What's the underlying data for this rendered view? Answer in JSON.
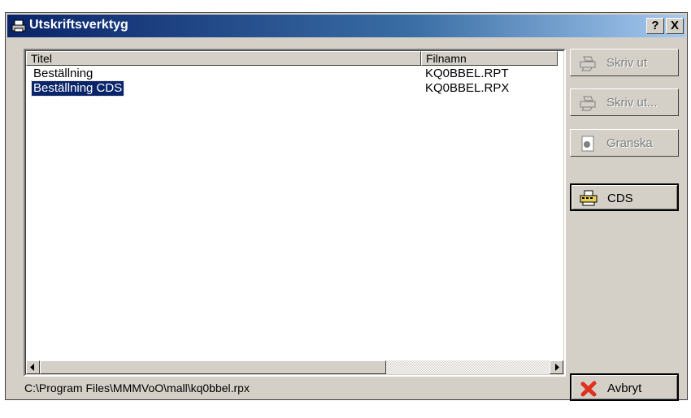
{
  "window": {
    "title": "Utskriftsverktyg",
    "help_label": "?",
    "close_label": "X"
  },
  "list": {
    "columns": [
      "Titel",
      "Filnamn"
    ],
    "rows": [
      {
        "title": "Beställning",
        "file": "KQ0BBEL.RPT",
        "selected": false
      },
      {
        "title": "Beställning CDS",
        "file": "KQ0BBEL.RPX",
        "selected": true
      }
    ]
  },
  "buttons": {
    "print_label": "Skriv ut",
    "print_dialog_label": "Skriv ut...",
    "preview_label": "Granska",
    "cds_label": "CDS",
    "cancel_label": "Avbryt"
  },
  "status": {
    "path": "C:\\Program Files\\MMMVoO\\mall\\kq0bbel.rpx"
  },
  "colors": {
    "selection": "#0a246a",
    "titlebar": "#0a246a",
    "face": "#d4d0c8"
  },
  "icons": [
    "printer-icon",
    "preview-icon",
    "cds-printer-icon",
    "red-x-icon"
  ]
}
